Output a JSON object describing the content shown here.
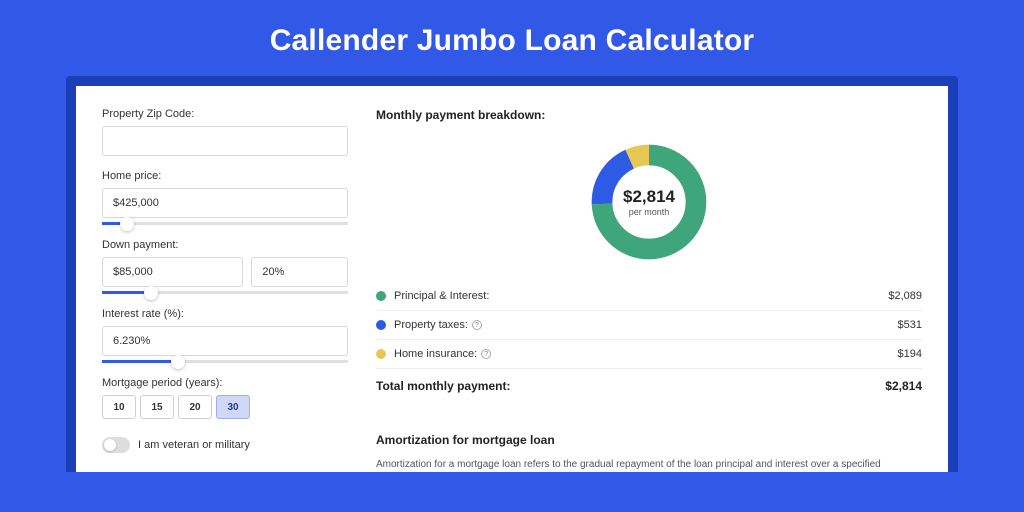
{
  "title": "Callender Jumbo Loan Calculator",
  "form": {
    "zip_label": "Property Zip Code:",
    "zip_value": "",
    "home_price_label": "Home price:",
    "home_price_value": "$425,000",
    "down_payment_label": "Down payment:",
    "down_payment_value": "$85,000",
    "down_payment_pct": "20%",
    "interest_label": "Interest rate (%):",
    "interest_value": "6.230%",
    "period_label": "Mortgage period (years):",
    "periods": [
      "10",
      "15",
      "20",
      "30"
    ],
    "period_active": "30",
    "veteran_label": "I am veteran or military"
  },
  "breakdown": {
    "title": "Monthly payment breakdown:",
    "center_amount": "$2,814",
    "center_label": "per month",
    "items": [
      {
        "key": "pi",
        "label": "Principal & Interest:",
        "value": "$2,089",
        "color": "green",
        "info": false
      },
      {
        "key": "tax",
        "label": "Property taxes:",
        "value": "$531",
        "color": "blue",
        "info": true
      },
      {
        "key": "ins",
        "label": "Home insurance:",
        "value": "$194",
        "color": "yellow",
        "info": true
      }
    ],
    "total_label": "Total monthly payment:",
    "total_value": "$2,814"
  },
  "amortization": {
    "title": "Amortization for mortgage loan",
    "text": "Amortization for a mortgage loan refers to the gradual repayment of the loan principal and interest over a specified"
  },
  "chart_data": {
    "type": "pie",
    "title": "Monthly payment breakdown",
    "series": [
      {
        "name": "Principal & Interest",
        "value": 2089,
        "color": "#3fa57a"
      },
      {
        "name": "Property taxes",
        "value": 531,
        "color": "#2d5be3"
      },
      {
        "name": "Home insurance",
        "value": 194,
        "color": "#e8c855"
      }
    ],
    "total": 2814,
    "center_label": "$2,814 per month"
  }
}
